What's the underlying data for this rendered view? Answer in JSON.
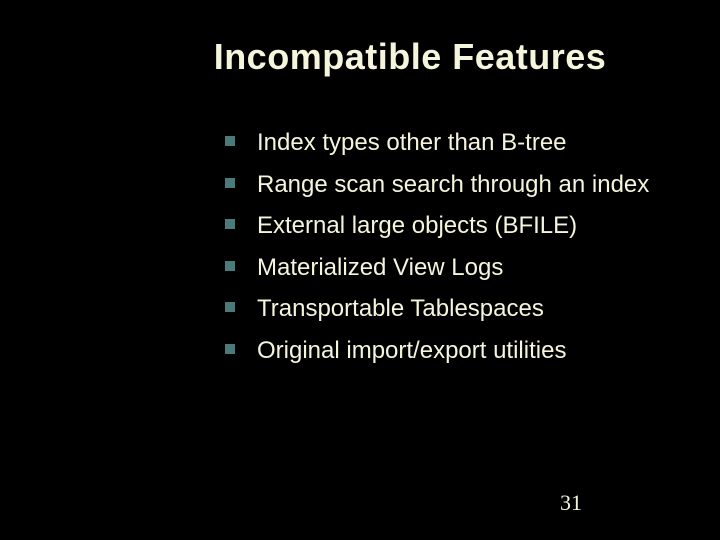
{
  "title": "Incompatible Features",
  "items": [
    "Index types other than B-tree",
    "Range scan search through an index",
    "External large objects (BFILE)",
    "Materialized View Logs",
    "Transportable Tablespaces",
    "Original import/export utilities"
  ],
  "pageNumber": "31"
}
